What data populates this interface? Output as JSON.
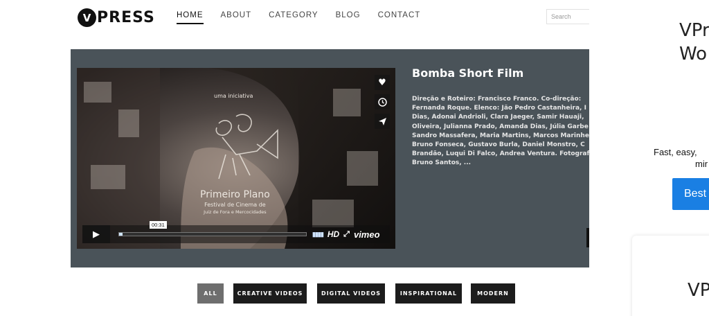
{
  "header": {
    "logo_letter": "V",
    "logo_text": "PRESS",
    "nav": [
      "HOME",
      "ABOUT",
      "CATEGORY",
      "BLOG",
      "CONTACT"
    ],
    "active_nav": "HOME",
    "search_placeholder": "Search"
  },
  "player": {
    "title": "Bomba Short Film",
    "description_lines": [
      "Direção e Roteiro: Francisco Franco. Co-direção:",
      "Fernanda Roque. Elenco: Jão Pedro Castanheira, I",
      "Dias, Adonai Andrioli, Clara Jaeger, Samir Hauaji,",
      "Oliveira, Julianna Prado, Amanda Dias, Júlia Garbe",
      "Sandro Massafera, Maria Martins, Marcos Marinhe",
      "Bruno Fonseca, Gustavo Burla, Daniel Monstro, C",
      "Brandão, Luqui Di Falco, Andrea Ventura. Fotograf",
      "Bruno Santos, ..."
    ],
    "video_text": {
      "initiative": "uma iniciativa",
      "festival_name": "Primeiro Plano",
      "festival_line1": "Festival de Cinema de",
      "festival_line2": "Juiz de Fora e Mercocidades"
    },
    "time": "00:31",
    "hd_label": "HD",
    "vimeo_label": "vimeo",
    "progress": 0.02,
    "side_icons": [
      "heart-icon",
      "clock-icon",
      "send-icon"
    ]
  },
  "filters": {
    "items": [
      "ALL",
      "CREATIVE VIDEOS",
      "DIGITAL VIDEOS",
      "INSPIRATIONAL",
      "MODERN"
    ],
    "active": "ALL"
  },
  "ad": {
    "title_line1": "VPr",
    "title_line2": "Wo",
    "text_line1": "Fast, easy,",
    "text_line2": "mir",
    "button": "Best",
    "card_title": "VP"
  },
  "colors": {
    "stage_bg": "#4a5359",
    "button_dark": "#1c1c1c",
    "button_active": "#6e6e6e",
    "ad_button": "#1a7fe3"
  }
}
